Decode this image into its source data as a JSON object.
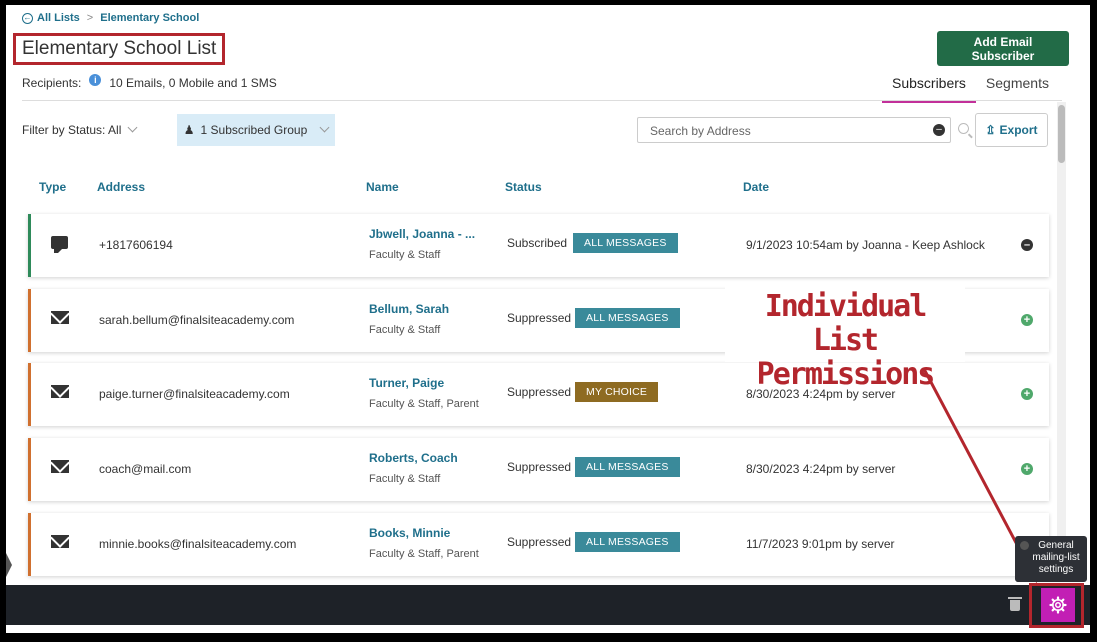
{
  "breadcrumb": {
    "root": "All Lists",
    "current": "Elementary School"
  },
  "page_title": "Elementary School List",
  "add_button": "Add Email Subscriber",
  "recipients": {
    "label": "Recipients:",
    "value": "10 Emails, 0 Mobile and 1 SMS"
  },
  "tabs": [
    {
      "label": "Subscribers",
      "active": true
    },
    {
      "label": "Segments",
      "active": false
    }
  ],
  "filter": {
    "status_label": "Filter by Status: All",
    "group_label": "1 Subscribed Group"
  },
  "search": {
    "placeholder": "Search by Address"
  },
  "export_label": "Export",
  "columns": [
    "Type",
    "Address",
    "Name",
    "Status",
    "Date"
  ],
  "rows": [
    {
      "type": "sms-icon",
      "address": "+1817606194",
      "name": "Jbwell, Joanna - ...",
      "roles": "Faculty & Staff",
      "status": "Subscribed",
      "badge": "ALL MESSAGES",
      "date": "9/1/2023 10:54am by Joanna - Keep Ashlock",
      "action": "remove"
    },
    {
      "type": "email-icon",
      "address": "sarah.bellum@finalsiteacademy.com",
      "name": "Bellum, Sarah",
      "roles": "Faculty & Staff",
      "status": "Suppressed",
      "badge": "ALL MESSAGES",
      "date": "",
      "action": "add"
    },
    {
      "type": "email-icon",
      "address": "paige.turner@finalsiteacademy.com",
      "name": "Turner, Paige",
      "roles": "Faculty & Staff, Parent",
      "status": "Suppressed",
      "badge": "MY CHOICE",
      "date": "8/30/2023 4:24pm by server",
      "action": "add"
    },
    {
      "type": "email-icon",
      "address": "coach@mail.com",
      "name": "Roberts, Coach",
      "roles": "Faculty & Staff",
      "status": "Suppressed",
      "badge": "ALL MESSAGES",
      "date": "8/30/2023 4:24pm by server",
      "action": "add"
    },
    {
      "type": "email-icon",
      "address": "minnie.books@finalsiteacademy.com",
      "name": "Books, Minnie",
      "roles": "Faculty & Staff, Parent",
      "status": "Suppressed",
      "badge": "ALL MESSAGES",
      "date": "11/7/2023 9:01pm by server",
      "action": "add"
    }
  ],
  "callout": {
    "line1": "Individual List",
    "line2": "Permissions"
  },
  "tooltip": "General mailing-list settings",
  "colors": {
    "accent": "#1f6f8b",
    "primary_button": "#226b47",
    "settings_button": "#c21fb4",
    "annotation": "#b3262d"
  }
}
